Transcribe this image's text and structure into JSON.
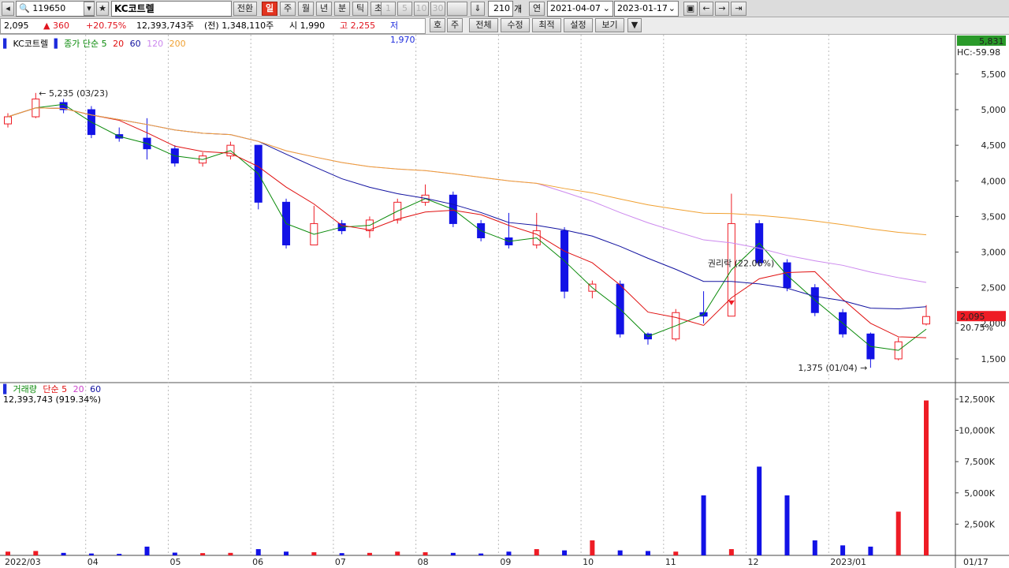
{
  "toolbar": {
    "code": "119650",
    "name": "KC코트렐",
    "convert": "전환",
    "periods": [
      "일",
      "주",
      "월",
      "년",
      "분",
      "틱",
      "초"
    ],
    "active_period": "일",
    "intervals": [
      "1",
      "5",
      "10",
      "30"
    ],
    "count": "210",
    "count_unit": "개",
    "date_mode": "연",
    "start_date": "2021-04-07",
    "end_date": "2023-01-17"
  },
  "quote": {
    "price": "2,095",
    "change": "▲ 360",
    "change_pct": "+20.75%",
    "volume": "12,393,743주",
    "prev_volume": "(전) 1,348,110주",
    "open": "시 1,990",
    "high": "고 2,255",
    "low": "저 1,970"
  },
  "toolbar2": {
    "quote_btn": "호",
    "stock_btn": "주",
    "menus": [
      "전체",
      "수정",
      "최적",
      "설정",
      "보기"
    ]
  },
  "price_legend": {
    "name": "KC코트렐",
    "ma_label": "종가 단순 5",
    "periods": [
      "20",
      "60",
      "120",
      "200"
    ]
  },
  "volume_legend": {
    "name": "거래량",
    "ma_label": "단순 5",
    "periods": [
      "20",
      "60"
    ],
    "value": "12,393,743 (919.34%)"
  },
  "right_panel": {
    "top_value": "5,831",
    "hc_value": "HC:-59.98",
    "current_price": "2,095",
    "current_pct": "20.75%"
  },
  "colors": {
    "up": "#ee1c25",
    "down": "#1212e6",
    "ma5": "#0a8a0a",
    "ma20": "#e01010",
    "ma60": "#1212a0",
    "ma120": "#cc88ee",
    "ma200": "#f0a030"
  },
  "chart_data": {
    "type": "candlestick",
    "symbol": "KC코트렐",
    "code": "119650",
    "price_axis": {
      "ticks": [
        "5,500",
        "5,000",
        "4,500",
        "4,000",
        "3,500",
        "3,000",
        "2,500",
        "2,000",
        "1,500"
      ],
      "range": [
        1200,
        5831
      ]
    },
    "volume_axis": {
      "ticks": [
        "12,500K",
        "10,000K",
        "7,500K",
        "5,000K",
        "2,500K"
      ],
      "range": [
        0,
        13000
      ]
    },
    "x_labels": [
      "2022/03",
      "04",
      "05",
      "06",
      "07",
      "08",
      "09",
      "10",
      "11",
      "12",
      "2023/01",
      "01/17"
    ],
    "annotations": [
      {
        "label": "5,235 (03/23)",
        "type": "high",
        "value": 5235
      },
      {
        "label": "1,375 (01/04)",
        "type": "low",
        "value": 1375
      },
      {
        "label": "권리락 (22.06%)",
        "type": "event"
      }
    ],
    "ohlc": [
      {
        "m": "2022/03",
        "o": 4800,
        "h": 4950,
        "l": 4750,
        "c": 4900
      },
      {
        "m": "2022/03",
        "o": 4900,
        "h": 5235,
        "l": 4880,
        "c": 5150
      },
      {
        "m": "04",
        "o": 5100,
        "h": 5150,
        "l": 4950,
        "c": 5000
      },
      {
        "m": "04",
        "o": 5000,
        "h": 5050,
        "l": 4600,
        "c": 4650
      },
      {
        "m": "04",
        "o": 4650,
        "h": 4750,
        "l": 4550,
        "c": 4600
      },
      {
        "m": "05",
        "o": 4600,
        "h": 4880,
        "l": 4300,
        "c": 4450
      },
      {
        "m": "05",
        "o": 4450,
        "h": 4500,
        "l": 4200,
        "c": 4250
      },
      {
        "m": "05",
        "o": 4250,
        "h": 4400,
        "l": 4200,
        "c": 4350
      },
      {
        "m": "06",
        "o": 4350,
        "h": 4550,
        "l": 4300,
        "c": 4500
      },
      {
        "m": "06",
        "o": 4500,
        "h": 4500,
        "l": 3600,
        "c": 3700
      },
      {
        "m": "06",
        "o": 3700,
        "h": 3750,
        "l": 3050,
        "c": 3100
      },
      {
        "m": "07",
        "o": 3100,
        "h": 3650,
        "l": 3100,
        "c": 3400
      },
      {
        "m": "07",
        "o": 3400,
        "h": 3450,
        "l": 3250,
        "c": 3300
      },
      {
        "m": "07",
        "o": 3300,
        "h": 3500,
        "l": 3200,
        "c": 3450
      },
      {
        "m": "08",
        "o": 3450,
        "h": 3750,
        "l": 3400,
        "c": 3700
      },
      {
        "m": "08",
        "o": 3700,
        "h": 3950,
        "l": 3650,
        "c": 3800
      },
      {
        "m": "08",
        "o": 3800,
        "h": 3850,
        "l": 3350,
        "c": 3400
      },
      {
        "m": "09",
        "o": 3400,
        "h": 3450,
        "l": 3150,
        "c": 3200
      },
      {
        "m": "09",
        "o": 3200,
        "h": 3550,
        "l": 3050,
        "c": 3100
      },
      {
        "m": "09",
        "o": 3100,
        "h": 3550,
        "l": 3050,
        "c": 3300
      },
      {
        "m": "10",
        "o": 3300,
        "h": 3350,
        "l": 2350,
        "c": 2450
      },
      {
        "m": "10",
        "o": 2450,
        "h": 2600,
        "l": 2350,
        "c": 2550
      },
      {
        "m": "10",
        "o": 2550,
        "h": 2600,
        "l": 1800,
        "c": 1850
      },
      {
        "m": "11",
        "o": 1850,
        "h": 1870,
        "l": 1700,
        "c": 1780
      },
      {
        "m": "11",
        "o": 1780,
        "h": 2200,
        "l": 1750,
        "c": 2150
      },
      {
        "m": "11",
        "o": 2150,
        "h": 2450,
        "l": 2000,
        "c": 2100
      },
      {
        "m": "11",
        "o": 2100,
        "h": 3820,
        "l": 2100,
        "c": 3400
      },
      {
        "m": "12",
        "o": 3400,
        "h": 3450,
        "l": 2800,
        "c": 2850
      },
      {
        "m": "12",
        "o": 2850,
        "h": 2900,
        "l": 2450,
        "c": 2500
      },
      {
        "m": "12",
        "o": 2500,
        "h": 2550,
        "l": 2100,
        "c": 2150
      },
      {
        "m": "12",
        "o": 2150,
        "h": 2200,
        "l": 1800,
        "c": 1850
      },
      {
        "m": "2023/01",
        "o": 1850,
        "h": 1870,
        "l": 1375,
        "c": 1500
      },
      {
        "m": "2023/01",
        "o": 1500,
        "h": 1800,
        "l": 1480,
        "c": 1740
      },
      {
        "m": "01/17",
        "o": 1990,
        "h": 2255,
        "l": 1970,
        "c": 2095
      }
    ],
    "volume_k": [
      300,
      350,
      200,
      150,
      120,
      700,
      220,
      180,
      200,
      500,
      300,
      250,
      180,
      200,
      300,
      250,
      200,
      150,
      300,
      500,
      400,
      1200,
      400,
      350,
      300,
      4800,
      500,
      7100,
      4800,
      1200,
      800,
      700,
      3500,
      12394
    ]
  }
}
